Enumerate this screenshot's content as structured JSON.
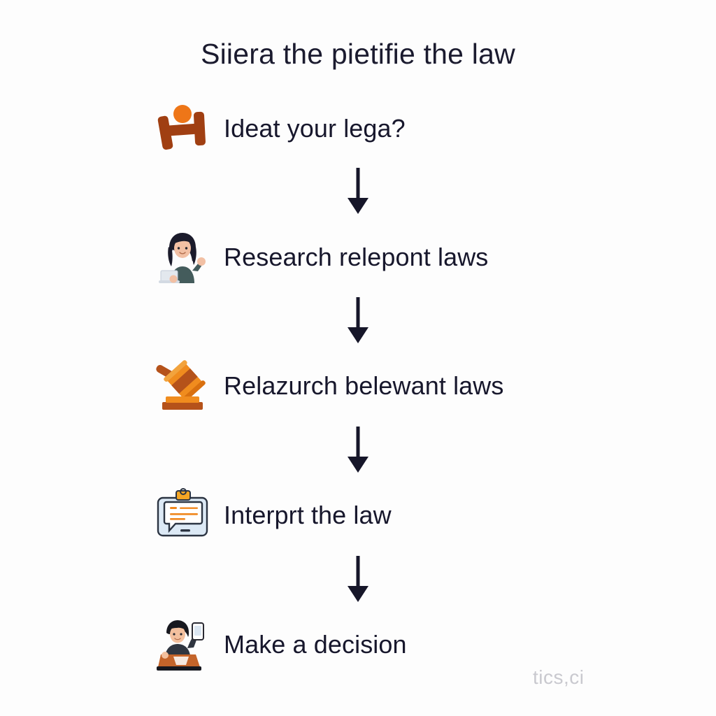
{
  "page": {
    "background_color": "#fdfdfd",
    "title": "Siiera the pietifie the law",
    "title_color": "#1b1b2f",
    "watermark": "tics,ci",
    "watermark_color": "#c9c9cf"
  },
  "flow": {
    "arrow_color": "#161629",
    "arrow_count": 4,
    "steps": [
      {
        "index": 1,
        "label": "Ideat your lega?",
        "icon": "abstract-h-shape-icon",
        "icon_colors": {
          "primary": "#a03f12",
          "accent": "#ee7618"
        }
      },
      {
        "index": 2,
        "label": "Research relepont laws",
        "icon": "woman-with-laptop-icon",
        "icon_colors": {
          "hair": "#1b1b2b",
          "top": "#445c5c",
          "skin": "#f2c0a4",
          "laptop": "#e3e8ee"
        }
      },
      {
        "index": 3,
        "label": "Relazurch belewant laws",
        "icon": "gavel-icon",
        "icon_colors": {
          "primary": "#f08c1e",
          "dark": "#b5521a"
        }
      },
      {
        "index": 4,
        "label": "Interprt the law",
        "icon": "clipboard-speech-icon",
        "icon_colors": {
          "board": "#dce9f5",
          "outline": "#2b3442",
          "clip": "#f5a623"
        }
      },
      {
        "index": 5,
        "label": "Make a decision",
        "icon": "person-with-phone-laptop-icon",
        "icon_colors": {
          "hair": "#17181f",
          "shirt": "#2f3540",
          "desk": "#c4642a",
          "skin": "#f3c09e"
        }
      }
    ]
  }
}
